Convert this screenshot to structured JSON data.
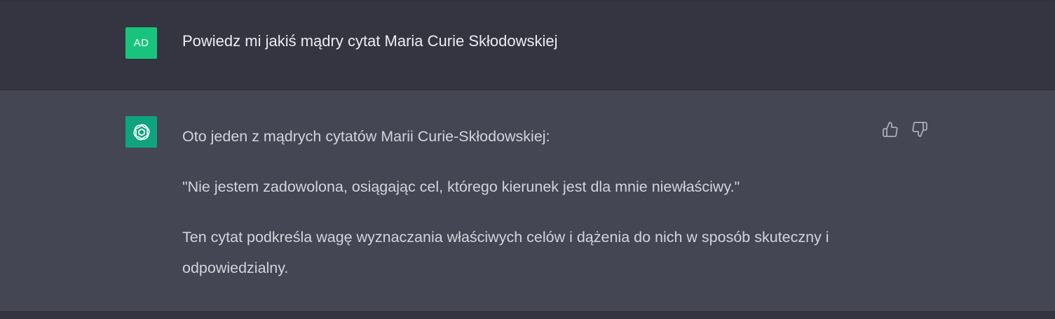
{
  "conversation": {
    "user_message": {
      "avatar_initials": "AD",
      "avatar_color": "#19c37d",
      "text": "Powiedz mi jakiś mądry cytat Maria Curie Skłodowskiej"
    },
    "assistant_message": {
      "avatar_icon": "openai-logo-icon",
      "avatar_color": "#10a37f",
      "paragraphs": [
        "Oto jeden z mądrych cytatów Marii Curie-Skłodowskiej:",
        "\"Nie jestem zadowolona, osiągając cel, którego kierunek jest dla mnie niewłaściwy.\"",
        "Ten cytat podkreśla wagę wyznaczania właściwych celów i dążenia do nich w sposób skuteczny i odpowiedzialny."
      ],
      "feedback_icons": [
        "thumbs-up-icon",
        "thumbs-down-icon"
      ]
    }
  }
}
